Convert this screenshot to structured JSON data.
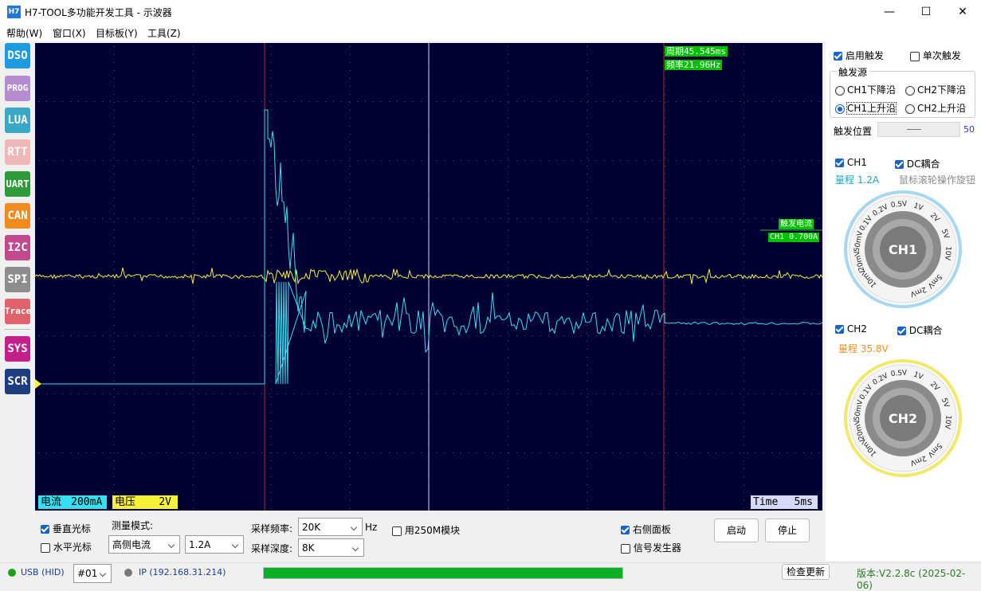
{
  "window": {
    "icon_text": "H7",
    "title": "H7-TOOL多功能开发工具 - 示波器",
    "min_glyph": "—",
    "max_glyph": "☐",
    "close_glyph": "✕"
  },
  "menu": [
    "帮助(W)",
    "窗口(X)",
    "目标板(Y)",
    "工具(Z)"
  ],
  "nav": [
    {
      "label": "DSO",
      "color": "#1e9be0"
    },
    {
      "label": "PROG",
      "color": "#b48ccf"
    },
    {
      "label": "LUA",
      "color": "#39a7c5"
    },
    {
      "label": "RTT",
      "color": "#f0b7b7"
    },
    {
      "label": "UART",
      "color": "#2f9a3a"
    },
    {
      "label": "CAN",
      "color": "#ef8c1d"
    },
    {
      "label": "I2C",
      "color": "#c04a8c"
    },
    {
      "label": "SPI",
      "color": "#8d8d8d"
    },
    {
      "label": "Trace",
      "color": "#e0636c"
    },
    {
      "label": "SYS",
      "color": "#c3208a"
    },
    {
      "label": "SCR",
      "color": "#1e3c80"
    }
  ],
  "scope": {
    "period": "周期45.545ms",
    "frequency": "频率21.96Hz",
    "trigger_label": "触发电流",
    "trigger_value": "CH1 0.700A",
    "ch1_scale_name": "电流",
    "ch1_scale_value": "200mA",
    "ch2_scale_name": "电压",
    "ch2_scale_value": "2V",
    "time_name": "Time",
    "time_value": "5ms",
    "ch1_color": "#35e0f0",
    "ch2_color": "#f5f038"
  },
  "right": {
    "enable_trigger": "启用触发",
    "single_trigger": "单次触发",
    "trigger_source": "触发源",
    "ch1_falling": "CH1下降沿",
    "ch2_falling": "CH2下降沿",
    "ch1_rising": "CH1上升沿",
    "ch2_rising": "CH2上升沿",
    "trigger_position": "触发位置",
    "trigger_position_value": "50",
    "ch1": "CH1",
    "dc_coupling_1": "DC耦合",
    "ch1_range": "量程 1.2A",
    "mouse_hint": "鼠标滚轮操作旋钮",
    "ch2": "CH2",
    "dc_coupling_2": "DC耦合",
    "ch2_range": "量程 35.8V",
    "knob1_label": "CH1",
    "knob2_label": "CH2",
    "knob_ticks": [
      "10mV",
      "20mV",
      "50mV",
      "0.1V",
      "0.2V",
      "0.5V",
      "1V",
      "2V",
      "5V",
      "10V",
      "2mV",
      "5mV"
    ]
  },
  "bottom": {
    "vertical_cursor": "垂直光标",
    "horizontal_cursor": "水平光标",
    "measure_mode": "测量模式:",
    "measure_mode_value": "高侧电流",
    "range_value": "1.2A",
    "sample_rate": "采样频率:",
    "sample_rate_value": "20K",
    "hz": "Hz",
    "sample_depth": "采样深度:",
    "sample_depth_value": "8K",
    "use_250m": "用250M模块",
    "right_panel": "右侧面板",
    "signal_gen": "信号发生器",
    "start": "启动",
    "stop": "停止"
  },
  "status": {
    "usb": "USB (HID)",
    "device": "#01",
    "ip": "IP (192.168.31.214)",
    "progress": 1.0,
    "check_update": "检查更新",
    "version": "版本:V2.2.8c (2025-02-06)"
  }
}
